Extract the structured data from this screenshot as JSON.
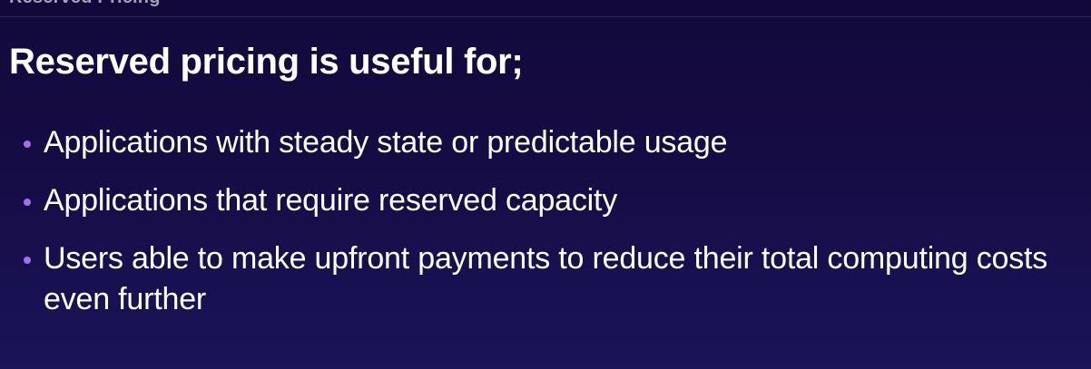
{
  "slide": {
    "previous_title_cut": "Reserved Pricing",
    "heading": "Reserved pricing is useful for;",
    "bullets": [
      "Applications with steady state or predictable usage",
      "Applications that require reserved capacity",
      "Users able to make upfront payments to reduce their total computing costs even further"
    ]
  },
  "colors": {
    "background_top": "#12093a",
    "background_bottom": "#1a1458",
    "bullet_dot": "#a56cf5",
    "text": "#ffffff"
  }
}
